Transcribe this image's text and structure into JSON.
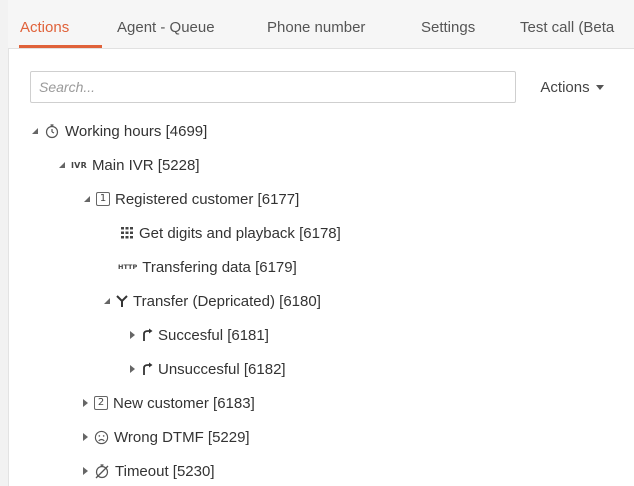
{
  "tabs": [
    {
      "label": "Actions",
      "active": true
    },
    {
      "label": "Agent - Queue",
      "active": false
    },
    {
      "label": "Phone number",
      "active": false
    },
    {
      "label": "Settings",
      "active": false
    },
    {
      "label": "Test call (Beta",
      "active": false
    }
  ],
  "search": {
    "placeholder": "Search...",
    "value": ""
  },
  "actions_menu": {
    "label": "Actions"
  },
  "tree": [
    {
      "label": "Working hours [4699]",
      "icon": "stopwatch-icon",
      "expanded": true
    },
    {
      "label": "Main IVR [5228]",
      "icon": "ivr-icon",
      "icon_text": "IVR",
      "expanded": true
    },
    {
      "label": "Registered customer [6177]",
      "icon": "number-1-icon",
      "icon_text": "1",
      "expanded": true
    },
    {
      "label": "Get digits and playback [6178]",
      "icon": "keypad-icon",
      "expanded": null
    },
    {
      "label": "Transfering data [6179]",
      "icon": "http-icon",
      "icon_text": "HTTP",
      "expanded": null
    },
    {
      "label": "Transfer (Depricated) [6180]",
      "icon": "transfer-fork-icon",
      "expanded": true
    },
    {
      "label": "Succesful [6181]",
      "icon": "branch-arrow-icon",
      "expanded": false
    },
    {
      "label": "Unsuccesful [6182]",
      "icon": "branch-arrow-icon",
      "expanded": false
    },
    {
      "label": "New customer [6183]",
      "icon": "number-2-icon",
      "icon_text": "2",
      "expanded": false
    },
    {
      "label": "Wrong DTMF [5229]",
      "icon": "sad-face-icon",
      "expanded": false
    },
    {
      "label": "Timeout [5230]",
      "icon": "timeout-stopwatch-icon",
      "expanded": false
    }
  ],
  "colors": {
    "accent": "#e0623a",
    "text": "#333333",
    "tab_bg": "#f6f6f6"
  }
}
